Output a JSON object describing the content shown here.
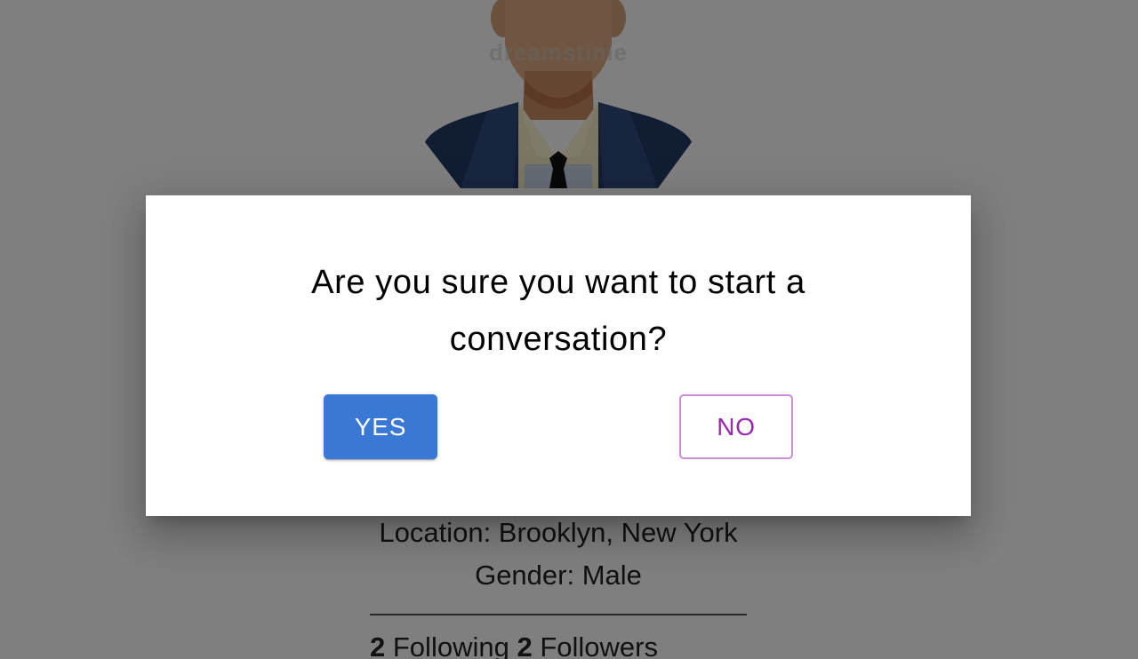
{
  "profile": {
    "watermark": "dreamstime",
    "location_line": "Location: Brooklyn, New York",
    "gender_line": "Gender: Male",
    "following_count": "2",
    "following_label": "Following",
    "followers_count": "2",
    "followers_label": "Followers"
  },
  "dialog": {
    "message": "Are you sure you want to start a conversation?",
    "yes_label": "YES",
    "no_label": "NO"
  },
  "colors": {
    "overlay": "#000000",
    "yes_button": "#3a78d6",
    "no_button_text": "#9c27b0",
    "no_button_border": "#c98fd3"
  }
}
